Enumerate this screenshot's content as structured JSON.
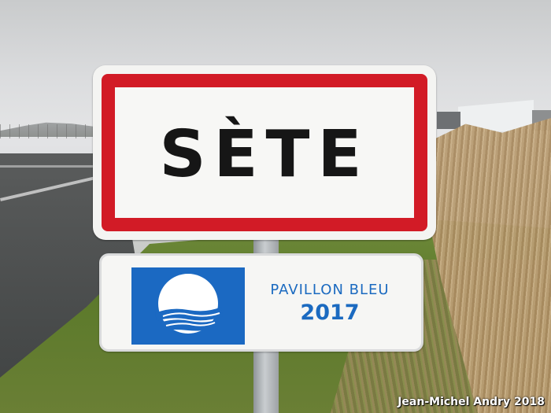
{
  "town_sign": {
    "name": "SÈTE",
    "border_color": "#d21b26",
    "background_color": "#f7f7f5"
  },
  "flag_sign": {
    "title": "PAVILLON BLEU",
    "year": "2017",
    "flag_color": "#1b69c2",
    "text_color": "#1b6ac0"
  },
  "photo_credit": "Jean-Michel Andry 2018"
}
